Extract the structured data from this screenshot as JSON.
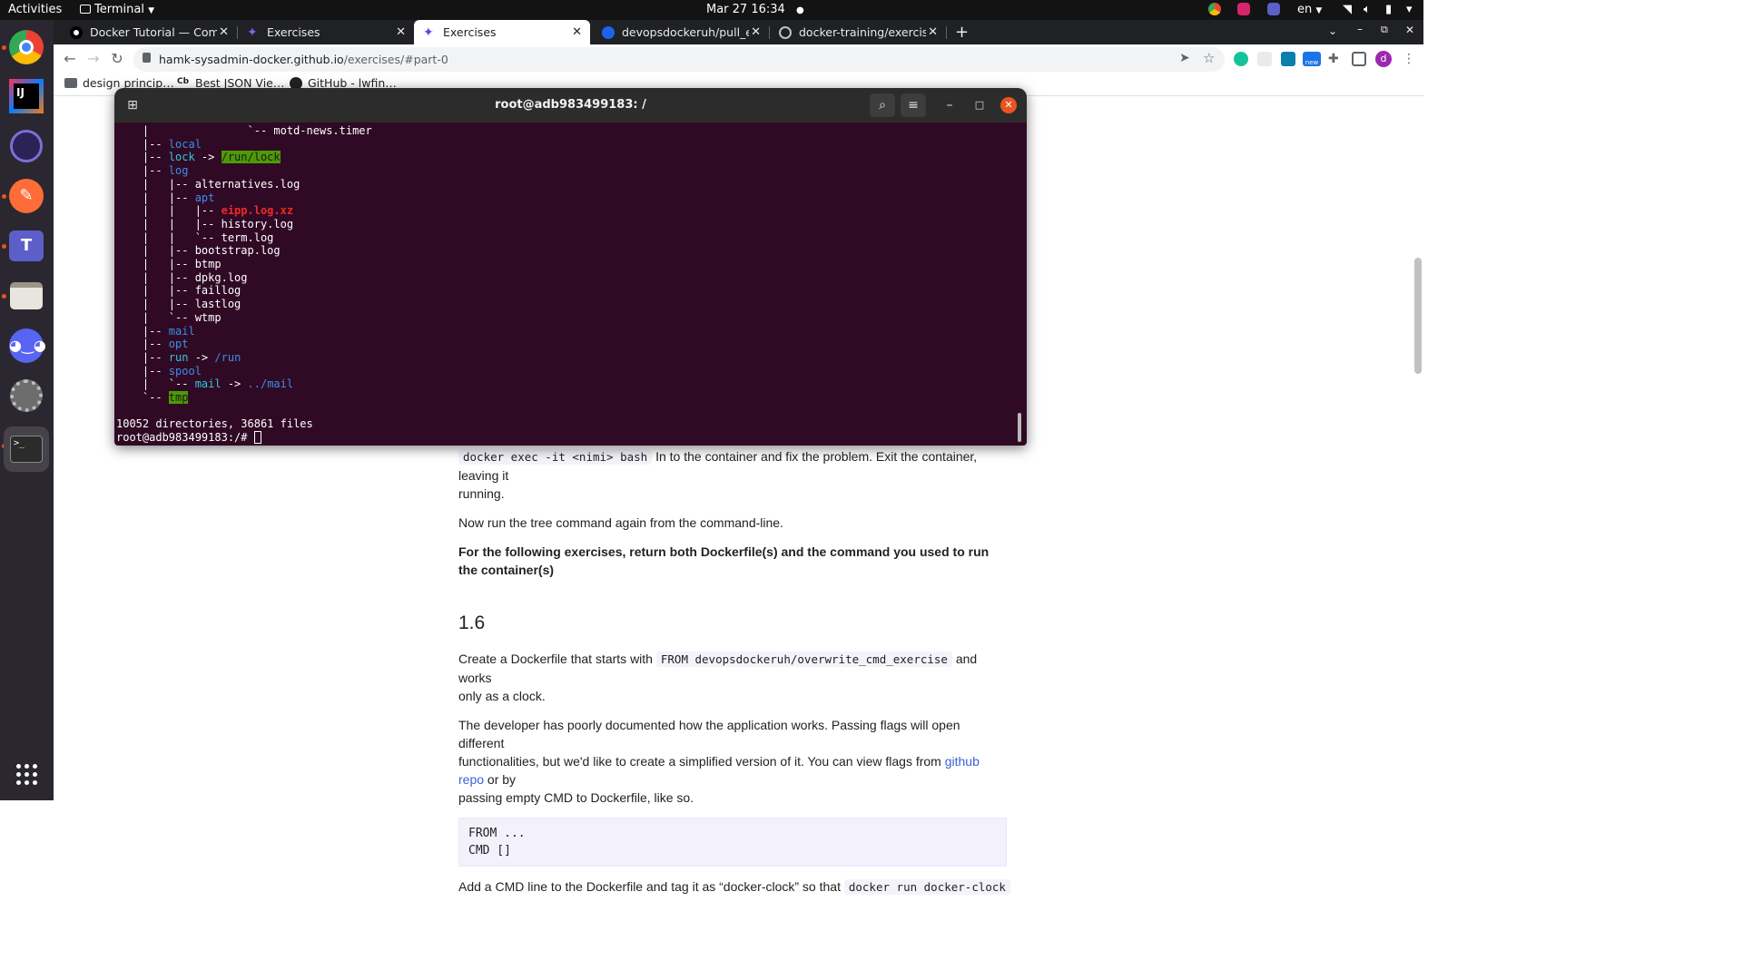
{
  "topbar": {
    "activities": "Activities",
    "app_menu": "Terminal",
    "clock": "Mar 27  16:34",
    "language": "en"
  },
  "dock": {
    "apps": [
      "Google Chrome",
      "IntelliJ IDEA",
      "Eclipse",
      "Postman",
      "Microsoft Teams",
      "Files",
      "Discord",
      "Settings",
      "Terminal"
    ]
  },
  "browser": {
    "tabs": [
      {
        "title": "Docker Tutorial — Compl",
        "icon": "docker-tab-icon"
      },
      {
        "title": "Exercises",
        "icon": "exercises-tab-icon"
      },
      {
        "title": "Exercises",
        "icon": "exercises-tab-icon",
        "active": true
      },
      {
        "title": "devopsdockeruh/pull_exe",
        "icon": "docker-hub-tab-icon"
      },
      {
        "title": "docker-training/exercises",
        "icon": "github-tab-icon"
      }
    ],
    "url_host": "hamk-sysadmin-docker.github.io",
    "url_path": "/exercises/#part-0",
    "bookmarks": [
      {
        "label": "design princip…"
      },
      {
        "label": "Best JSON Vie…"
      },
      {
        "label": "GitHub - lwfin…"
      }
    ],
    "extension_badge": "new",
    "profile_letter": "d"
  },
  "page": {
    "p1_code": "docker exec -it <nimi> bash",
    "p1_text_a": " In to the container and fix the problem. Exit the container, leaving it",
    "p1_text_b": "running.",
    "p2": "Now run the tree command again from the command-line.",
    "p3": "For the following exercises, return both Dockerfile(s) and the command you used to run the container(s)",
    "heading": "1.6",
    "p4_pre": "Create a Dockerfile that starts with ",
    "p4_code": "FROM devopsdockeruh/overwrite_cmd_exercise",
    "p4_post": " and works",
    "p4_line2": "only as a clock.",
    "p5_a": "The developer has poorly documented how the application works. Passing flags will open different",
    "p5_b": "functionalities, but we'd like to create a simplified version of it. You can view flags from ",
    "p5_link": "github repo",
    "p5_c": " or by",
    "p5_d": "passing empty CMD to Dockerfile, like so.",
    "code_line1": "FROM ...",
    "code_line2": "CMD []",
    "p6_pre": "Add a CMD line to the Dockerfile and tag it as “docker-clock” so that ",
    "p6_code": "docker run docker-clock"
  },
  "terminal": {
    "title": "root@adb983499183: /",
    "lines": [
      {
        "segs": [
          [
            "    |               `-- motd-news.timer",
            ""
          ]
        ]
      },
      {
        "segs": [
          [
            "    |-- ",
            ""
          ],
          [
            "local",
            "dir"
          ]
        ]
      },
      {
        "segs": [
          [
            "    |-- ",
            ""
          ],
          [
            "lock",
            "lnk"
          ],
          [
            " -> ",
            ""
          ],
          [
            "/run/lock",
            "hl"
          ]
        ]
      },
      {
        "segs": [
          [
            "    |-- ",
            ""
          ],
          [
            "log",
            "dir"
          ]
        ]
      },
      {
        "segs": [
          [
            "    |   |-- alternatives.log",
            ""
          ]
        ]
      },
      {
        "segs": [
          [
            "    |   |-- ",
            ""
          ],
          [
            "apt",
            "dir"
          ]
        ]
      },
      {
        "segs": [
          [
            "    |   |   |-- ",
            ""
          ],
          [
            "eipp.log.xz",
            "red"
          ]
        ]
      },
      {
        "segs": [
          [
            "    |   |   |-- history.log",
            ""
          ]
        ]
      },
      {
        "segs": [
          [
            "    |   |   `-- term.log",
            ""
          ]
        ]
      },
      {
        "segs": [
          [
            "    |   |-- bootstrap.log",
            ""
          ]
        ]
      },
      {
        "segs": [
          [
            "    |   |-- btmp",
            ""
          ]
        ]
      },
      {
        "segs": [
          [
            "    |   |-- dpkg.log",
            ""
          ]
        ]
      },
      {
        "segs": [
          [
            "    |   |-- faillog",
            ""
          ]
        ]
      },
      {
        "segs": [
          [
            "    |   |-- lastlog",
            ""
          ]
        ]
      },
      {
        "segs": [
          [
            "    |   `-- wtmp",
            ""
          ]
        ]
      },
      {
        "segs": [
          [
            "    |-- ",
            ""
          ],
          [
            "mail",
            "dir"
          ]
        ]
      },
      {
        "segs": [
          [
            "    |-- ",
            ""
          ],
          [
            "opt",
            "dir"
          ]
        ]
      },
      {
        "segs": [
          [
            "    |-- ",
            ""
          ],
          [
            "run",
            "lnk"
          ],
          [
            " -> ",
            ""
          ],
          [
            "/run",
            "dir"
          ]
        ]
      },
      {
        "segs": [
          [
            "    |-- ",
            ""
          ],
          [
            "spool",
            "dir"
          ]
        ]
      },
      {
        "segs": [
          [
            "    |   `-- ",
            ""
          ],
          [
            "mail",
            "lnk"
          ],
          [
            " -> ",
            ""
          ],
          [
            "../mail",
            "dir"
          ]
        ]
      },
      {
        "segs": [
          [
            "    `-- ",
            ""
          ],
          [
            "tmp",
            "hl"
          ]
        ]
      },
      {
        "segs": [
          [
            "",
            ""
          ]
        ]
      },
      {
        "segs": [
          [
            "10052 directories, 36861 files",
            ""
          ]
        ]
      }
    ],
    "prompt": "root@adb983499183:/# "
  },
  "colors": {
    "terminal_bg": "#300a24",
    "terminal_header": "#2c2c2c",
    "close_button": "#e95420",
    "dir_blue": "#3b8eea",
    "link_cyan": "#33c7de",
    "highlight_green": "#4e9a06"
  }
}
